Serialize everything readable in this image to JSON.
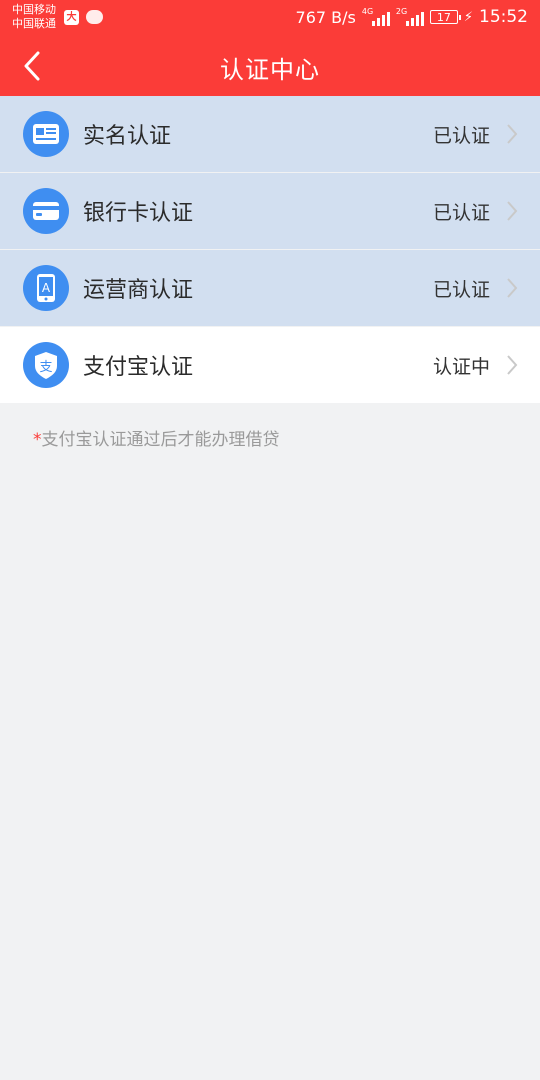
{
  "status_bar": {
    "carrier_1": "中国移动",
    "carrier_2": "中国联通",
    "net_speed": "767 B/s",
    "sim1_tag": "4G",
    "sim2_tag": "2G",
    "battery": "17",
    "time": "15:52"
  },
  "header": {
    "title": "认证中心"
  },
  "items": [
    {
      "label": "实名认证",
      "status": "已认证",
      "icon": "id-card-icon"
    },
    {
      "label": "银行卡认证",
      "status": "已认证",
      "icon": "bank-card-icon"
    },
    {
      "label": "运营商认证",
      "status": "已认证",
      "icon": "phone-carrier-icon"
    },
    {
      "label": "支付宝认证",
      "status": "认证中",
      "icon": "alipay-icon"
    }
  ],
  "note": {
    "star": "*",
    "text": "支付宝认证通过后才能办理借贷"
  },
  "colors": {
    "brand_red": "#fb3c38",
    "icon_blue": "#3f8ef1",
    "verified_row_bg": "#d2dff0",
    "page_bg": "#f1f2f3"
  }
}
